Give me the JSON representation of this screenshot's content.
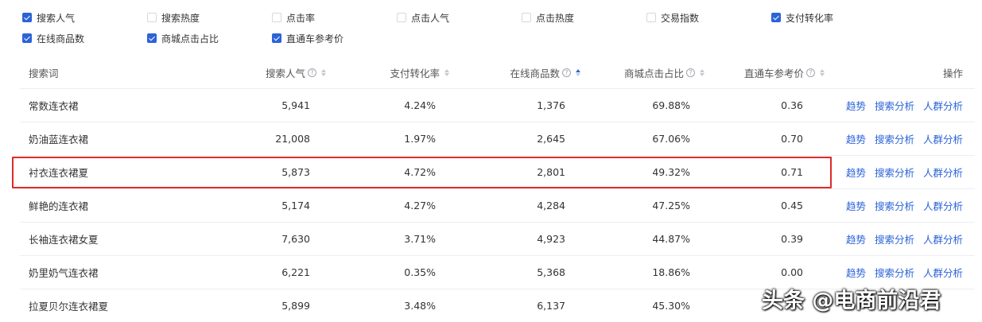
{
  "filters": {
    "row1": [
      {
        "label": "搜索人气",
        "checked": true
      },
      {
        "label": "搜索热度",
        "checked": false
      },
      {
        "label": "点击率",
        "checked": false
      },
      {
        "label": "点击人气",
        "checked": false
      },
      {
        "label": "点击热度",
        "checked": false
      },
      {
        "label": "交易指数",
        "checked": false
      },
      {
        "label": "支付转化率",
        "checked": true
      }
    ],
    "row2": [
      {
        "label": "在线商品数",
        "checked": true
      },
      {
        "label": "商城点击占比",
        "checked": true
      },
      {
        "label": "直通车参考价",
        "checked": true
      }
    ]
  },
  "table": {
    "headers": {
      "keyword": "搜索词",
      "search_popularity": "搜索人气",
      "pay_conversion": "支付转化率",
      "online_items": "在线商品数",
      "mall_click_ratio": "商城点击占比",
      "ztc_price": "直通车参考价",
      "actions": "操作"
    },
    "help_glyph": "?",
    "rows": [
      {
        "keyword": "常数连衣裙",
        "search_popularity": "5,941",
        "pay_conversion": "4.24%",
        "online_items": "1,376",
        "mall_click_ratio": "69.88%",
        "ztc_price": "0.36"
      },
      {
        "keyword": "奶油蓝连衣裙",
        "search_popularity": "21,008",
        "pay_conversion": "1.97%",
        "online_items": "2,645",
        "mall_click_ratio": "67.06%",
        "ztc_price": "0.70"
      },
      {
        "keyword": "衬衣连衣裙夏",
        "search_popularity": "5,873",
        "pay_conversion": "4.72%",
        "online_items": "2,801",
        "mall_click_ratio": "49.32%",
        "ztc_price": "0.71"
      },
      {
        "keyword": "鲜艳的连衣裙",
        "search_popularity": "5,174",
        "pay_conversion": "4.27%",
        "online_items": "4,284",
        "mall_click_ratio": "47.25%",
        "ztc_price": "0.45"
      },
      {
        "keyword": "长袖连衣裙女夏",
        "search_popularity": "7,630",
        "pay_conversion": "3.71%",
        "online_items": "4,923",
        "mall_click_ratio": "44.87%",
        "ztc_price": "0.39"
      },
      {
        "keyword": "奶里奶气连衣裙",
        "search_popularity": "6,221",
        "pay_conversion": "0.35%",
        "online_items": "5,368",
        "mall_click_ratio": "18.86%",
        "ztc_price": "0.00"
      },
      {
        "keyword": "拉夏贝尔连衣裙夏",
        "search_popularity": "5,899",
        "pay_conversion": "3.48%",
        "online_items": "6,137",
        "mall_click_ratio": "45.30%",
        "ztc_price": ""
      }
    ],
    "actions": {
      "trend": "趋势",
      "search_analysis": "搜索分析",
      "crowd_analysis": "人群分析"
    },
    "sort_active": "online_items"
  },
  "watermark": "头条 @电商前沿君",
  "colors": {
    "accent": "#2b63d9",
    "highlight": "#e02a2a"
  }
}
